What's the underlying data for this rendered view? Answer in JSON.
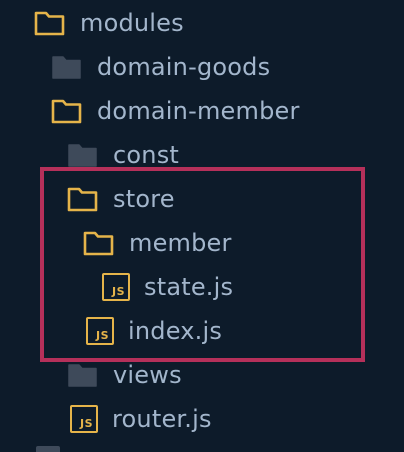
{
  "tree": {
    "items": [
      {
        "label": "modules",
        "icon": "folder-open-icon"
      },
      {
        "label": "domain-goods",
        "icon": "folder-closed-icon"
      },
      {
        "label": "domain-member",
        "icon": "folder-open-icon"
      },
      {
        "label": "const",
        "icon": "folder-closed-icon"
      },
      {
        "label": "store",
        "icon": "folder-open-icon"
      },
      {
        "label": "member",
        "icon": "folder-open-icon"
      },
      {
        "label": "state.js",
        "icon": "js-file-icon"
      },
      {
        "label": "index.js",
        "icon": "js-file-icon"
      },
      {
        "label": "views",
        "icon": "folder-closed-icon"
      },
      {
        "label": "router.js",
        "icon": "js-file-icon"
      }
    ],
    "js_badge_text": "JS"
  },
  "colors": {
    "background": "#0d1b2a",
    "text": "#a3b6cc",
    "folder_outline": "#e5b44a",
    "folder_closed_fill": "#3e4a5a",
    "js_badge": "#e5b44a",
    "highlight_border": "#b5305a"
  }
}
